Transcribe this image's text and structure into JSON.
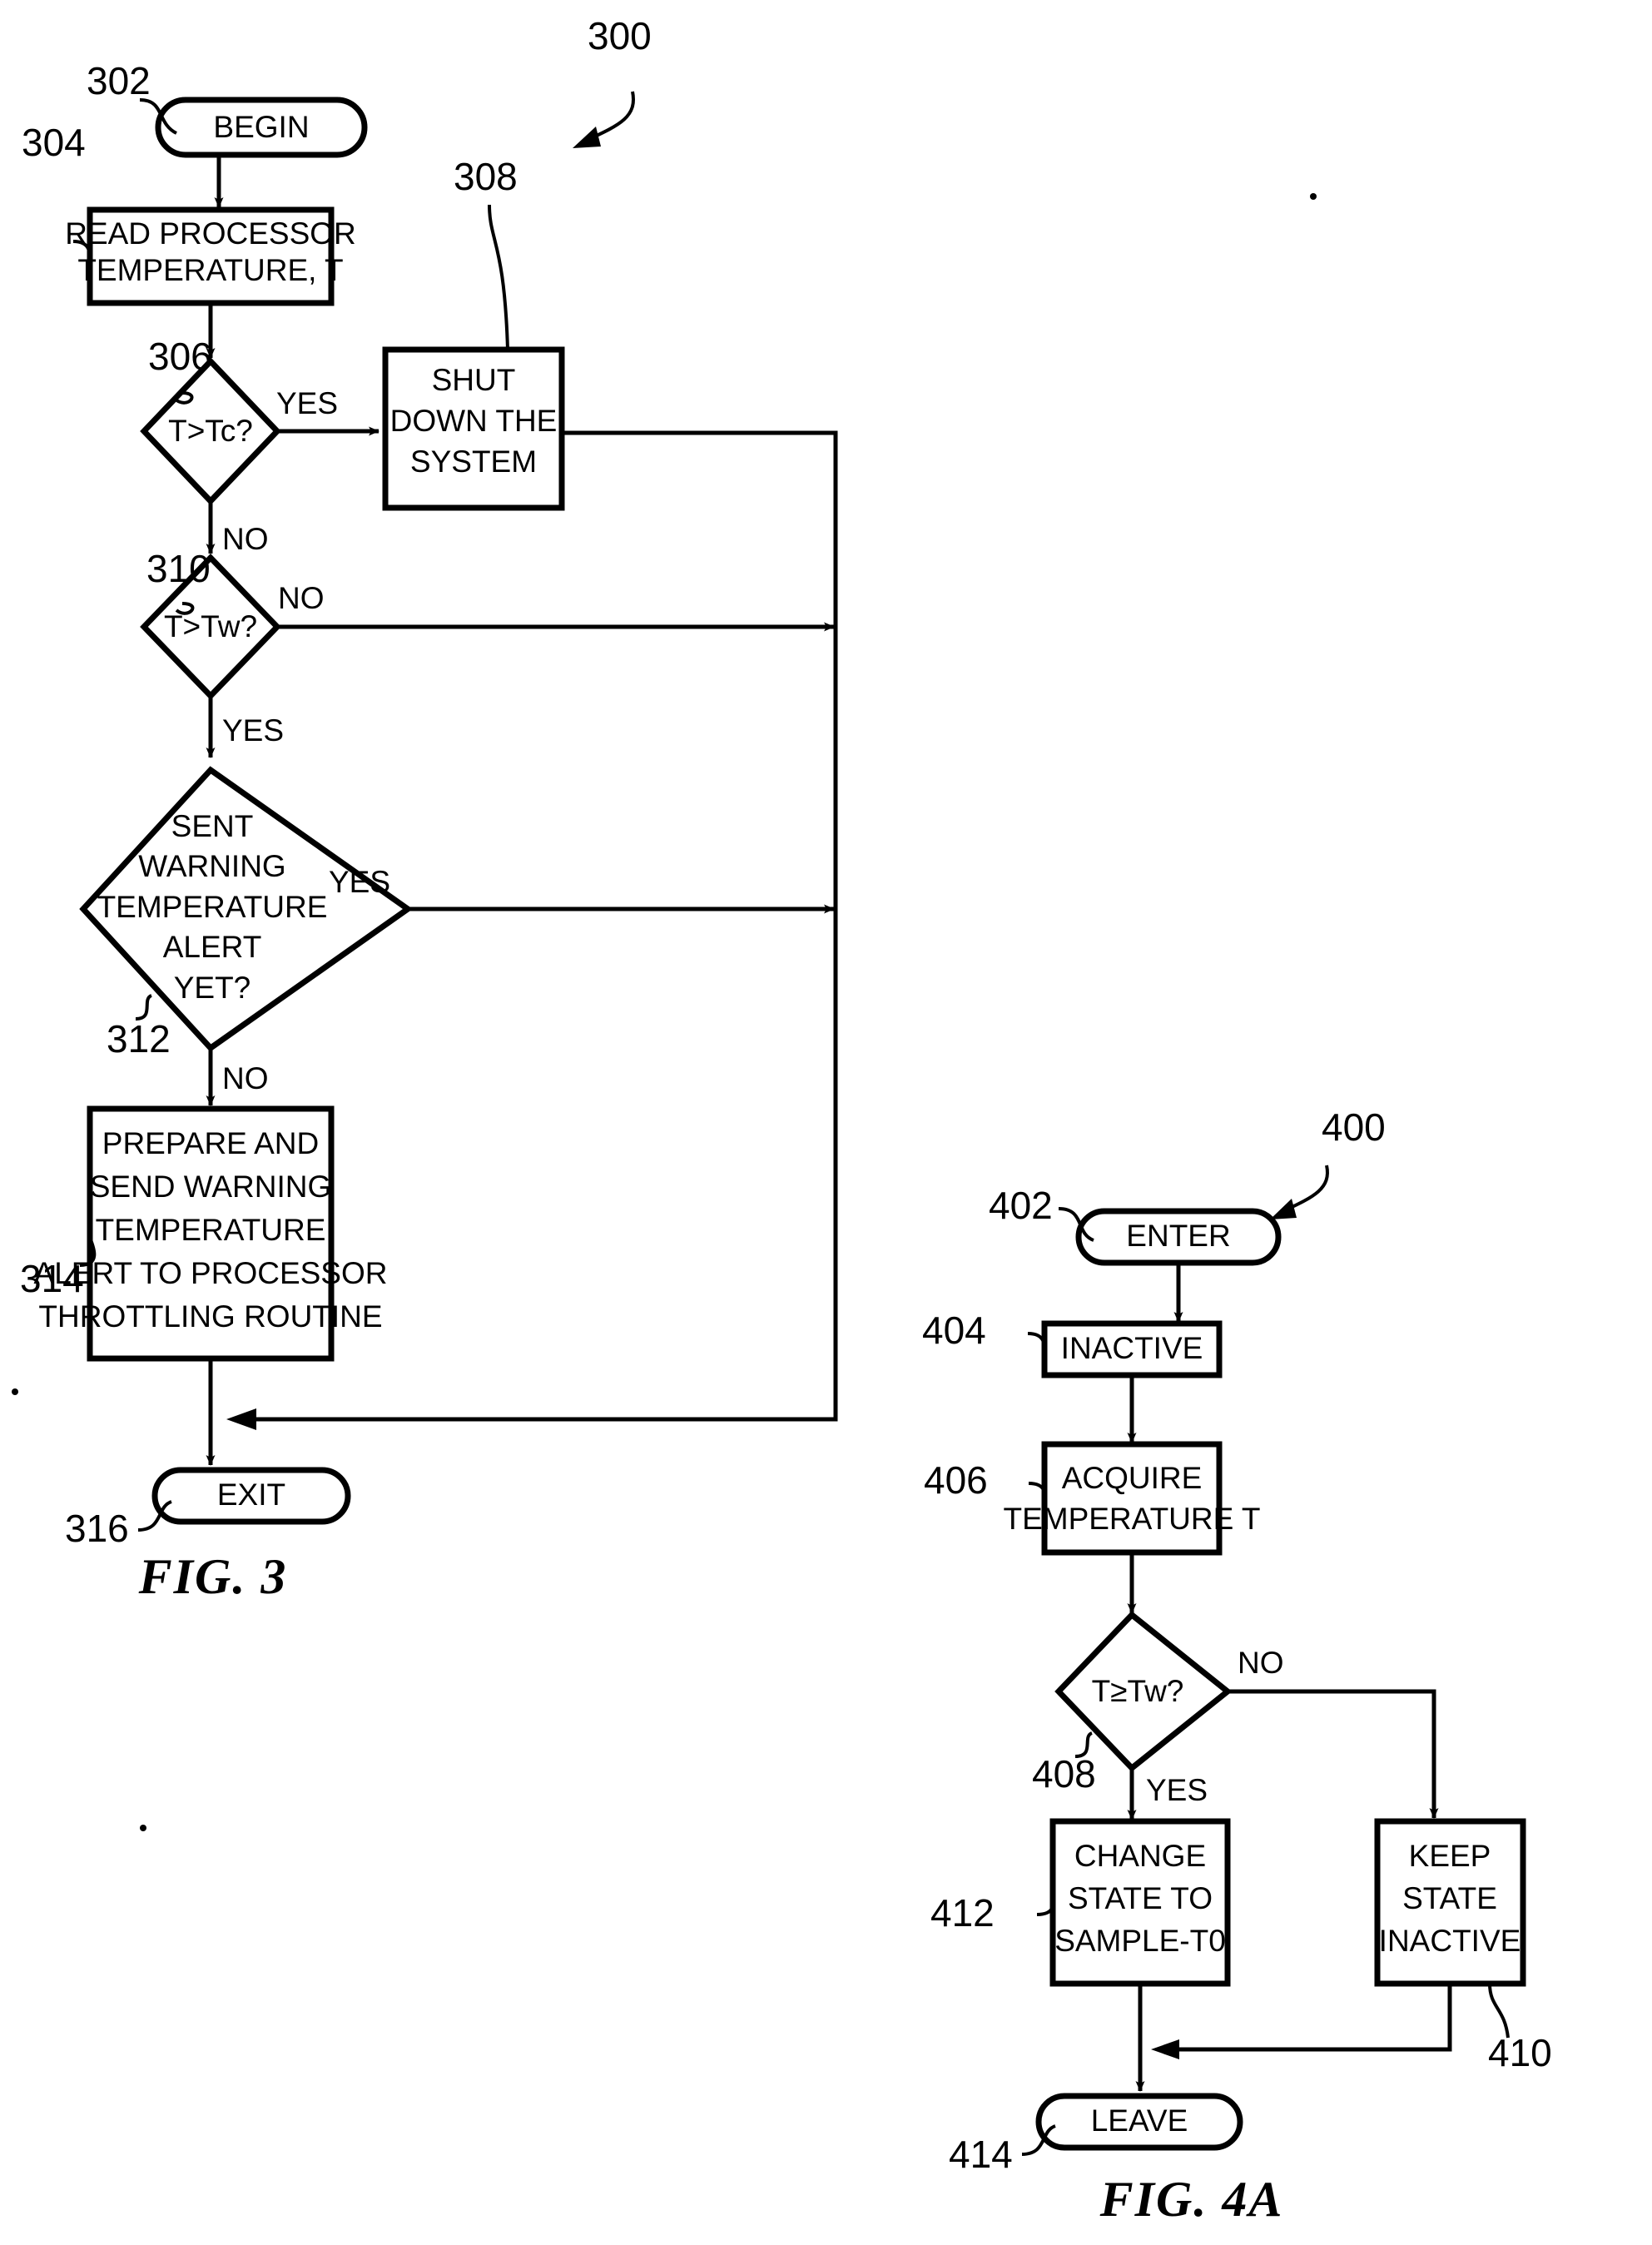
{
  "figures": [
    {
      "id": "fig3",
      "caption": "FIG. 3",
      "diagram_ref": "300",
      "nodes": [
        {
          "ref": "302",
          "type": "terminator",
          "label": "BEGIN"
        },
        {
          "ref": "304",
          "type": "process",
          "lines": [
            "READ PROCESSOR",
            "TEMPERATURE, T"
          ]
        },
        {
          "ref": "306",
          "type": "decision",
          "lines": [
            "T>Tc?"
          ]
        },
        {
          "ref": "308",
          "type": "process",
          "lines": [
            "SHUT",
            "DOWN THE",
            "SYSTEM"
          ]
        },
        {
          "ref": "310",
          "type": "decision",
          "lines": [
            "T>Tw?"
          ]
        },
        {
          "ref": "312",
          "type": "decision",
          "lines": [
            "SENT",
            "WARNING",
            "TEMPERATURE",
            "ALERT",
            "YET?"
          ]
        },
        {
          "ref": "314",
          "type": "process",
          "lines": [
            "PREPARE AND",
            "SEND WARNING",
            "TEMPERATURE",
            "ALERT TO PROCESSOR",
            "THROTTLING ROUTINE"
          ]
        },
        {
          "ref": "316",
          "type": "terminator",
          "label": "EXIT"
        }
      ],
      "edge_labels": [
        {
          "id": "e306-yes",
          "text": "YES"
        },
        {
          "id": "e306-no",
          "text": "NO"
        },
        {
          "id": "e310-no",
          "text": "NO"
        },
        {
          "id": "e310-yes",
          "text": "YES"
        },
        {
          "id": "e312-yes",
          "text": "YES"
        },
        {
          "id": "e312-no",
          "text": "NO"
        }
      ]
    },
    {
      "id": "fig4a",
      "caption": "FIG. 4A",
      "diagram_ref": "400",
      "nodes": [
        {
          "ref": "402",
          "type": "terminator",
          "label": "ENTER"
        },
        {
          "ref": "404",
          "type": "process",
          "lines": [
            "INACTIVE"
          ]
        },
        {
          "ref": "406",
          "type": "process",
          "lines": [
            "ACQUIRE",
            "TEMPERATURE T"
          ]
        },
        {
          "ref": "408",
          "type": "decision",
          "lines": [
            "T≥Tw?"
          ]
        },
        {
          "ref": "412",
          "type": "process",
          "lines": [
            "CHANGE",
            "STATE TO",
            "SAMPLE-T0"
          ]
        },
        {
          "ref": "410",
          "type": "process",
          "lines": [
            "KEEP",
            "STATE",
            "INACTIVE"
          ]
        },
        {
          "ref": "414",
          "type": "terminator",
          "label": "LEAVE"
        }
      ],
      "edge_labels": [
        {
          "id": "e408-no",
          "text": "NO"
        },
        {
          "id": "e408-yes",
          "text": "YES"
        }
      ]
    }
  ],
  "colors": {
    "ink": "#000000",
    "paper": "#ffffff"
  }
}
